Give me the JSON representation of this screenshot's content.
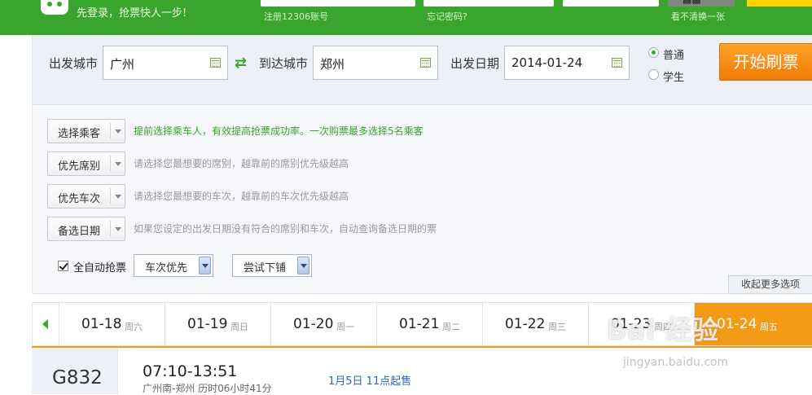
{
  "header": {
    "slogan": "先登录，抢票快人一步!",
    "register_caption": "注册12306账号",
    "forgot_caption": "忘记密码?",
    "captcha_caption": "看不清换一张",
    "brand_color": "#3aa52c"
  },
  "search": {
    "from_label": "出发城市",
    "from_value": "广州",
    "to_label": "到达城市",
    "to_value": "郑州",
    "date_label": "出发日期",
    "date_value": "2014-01-24",
    "ticket_types": [
      {
        "label": "普通",
        "selected": true
      },
      {
        "label": "学生",
        "selected": false
      }
    ],
    "start_button": "开始刷票"
  },
  "options": {
    "rows": [
      {
        "button": "选择乘客",
        "hint": "提前选择乘车人，有效提高抢票成功率。一次购票最多选择5名乘客"
      },
      {
        "button": "优先席别",
        "hint": "请选择您最想要的席别，越靠前的席别优先级越高"
      },
      {
        "button": "优先车次",
        "hint": "请选择您最想要的车次，越靠前的车次优先级越高"
      },
      {
        "button": "备选日期",
        "hint": "如果您设定的出发日期没有符合的席别和车次，自动查询备选日期的票"
      }
    ],
    "auto_grab_label": "全自动抢票",
    "auto_grab_checked": true,
    "priority_select": "车次优先",
    "berth_select": "尝试下铺",
    "collapse_label": "收起更多选项"
  },
  "date_tabs": [
    {
      "date": "01-18",
      "weekday": "周六",
      "active": false
    },
    {
      "date": "01-19",
      "weekday": "周日",
      "active": false
    },
    {
      "date": "01-20",
      "weekday": "周一",
      "active": false
    },
    {
      "date": "01-21",
      "weekday": "周二",
      "active": false
    },
    {
      "date": "01-22",
      "weekday": "周三",
      "active": false
    },
    {
      "date": "01-23",
      "weekday": "周四",
      "active": false
    },
    {
      "date": "01-24",
      "weekday": "周五",
      "active": true
    }
  ],
  "train": {
    "code": "G832",
    "times": "07:10-13:51",
    "route": "广州南-郑州 历时06小时41分",
    "sale_info": "1月5日 11点起售"
  },
  "watermark": {
    "text": "Bai 经验",
    "url_text": "jingyan.baidu.com"
  }
}
